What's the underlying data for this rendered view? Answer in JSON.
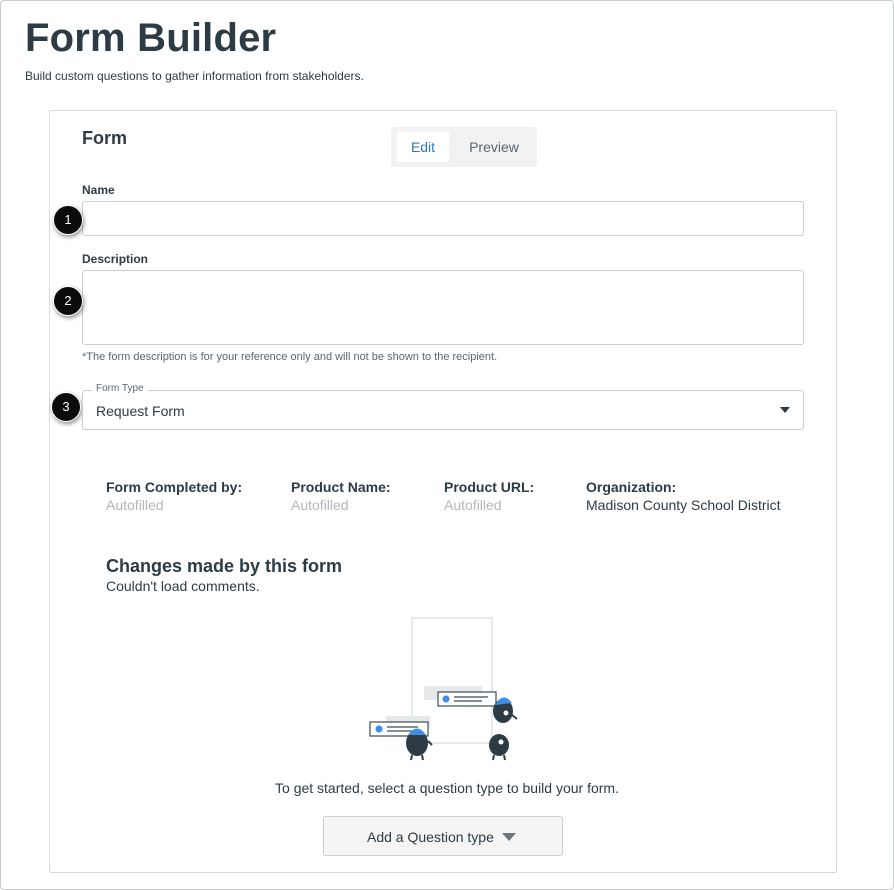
{
  "header": {
    "title": "Form Builder",
    "subtitle": "Build custom questions to gather information from stakeholders."
  },
  "form": {
    "title": "Form",
    "tabs": [
      {
        "label": "Edit",
        "active": true
      },
      {
        "label": "Preview",
        "active": false
      }
    ],
    "name_field": {
      "label": "Name",
      "value": "",
      "placeholder": ""
    },
    "description_field": {
      "label": "Description",
      "value": "",
      "placeholder": "",
      "hint": "*The form description is for your reference only and will not be shown to the recipient."
    },
    "form_type": {
      "legend": "Form Type",
      "value": "Request Form"
    },
    "meta": [
      {
        "label": "Form Completed by:",
        "value": "Autofilled"
      },
      {
        "label": "Product Name:",
        "value": "Autofilled"
      },
      {
        "label": "Product URL:",
        "value": "Autofilled"
      },
      {
        "label": "Organization:",
        "value": "Madison County School District"
      }
    ],
    "changes": {
      "title": "Changes made by this form",
      "status": "Couldn't load comments."
    },
    "empty_state": "To get started, select a question type to build your form.",
    "add_question_label": "Add a Question type"
  },
  "callouts": [
    "1",
    "2",
    "3"
  ],
  "colors": {
    "accent": "#2b7abc",
    "text": "#2d3b45",
    "muted": "#b0b7bd",
    "illustration_blue": "#3b8ee8"
  }
}
